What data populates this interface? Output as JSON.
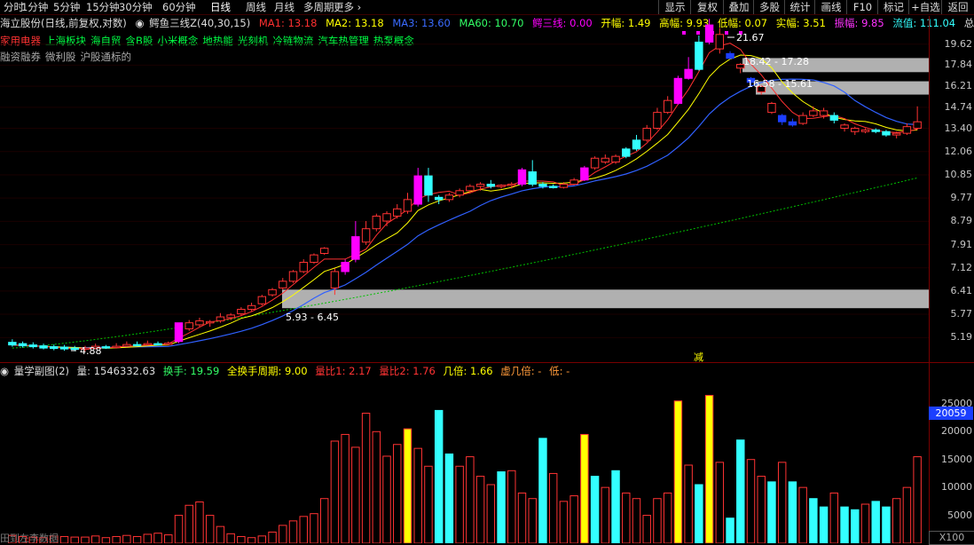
{
  "toolbar": {
    "periods": [
      "分时",
      "1分钟",
      "5分钟",
      "15分钟",
      "30分钟",
      "60分钟",
      "日线",
      "周线",
      "月线",
      "多周期",
      "更多 ›"
    ],
    "active_period": "日线",
    "right_buttons": [
      "显示",
      "复权",
      "叠加",
      "多股",
      "统计",
      "画线",
      "F10",
      "标记",
      "+自选",
      "返回"
    ]
  },
  "info": {
    "stock": "海立股份(日线,前复权,对数)",
    "indicator": "鳄鱼三线Z(40,30,15)",
    "ma1": "MA1: 13.18",
    "ma2": "MA2: 13.18",
    "ma3": "MA3: 13.60",
    "ma60": "MA60: 10.70",
    "e3": "鳄三线: 0.00",
    "open": "开幅: 1.49",
    "high": "高幅: 9.93",
    "low": "低幅: 0.07",
    "body": "实幅: 3.51",
    "amp": "振幅: 9.85",
    "float": "流值: 111.04",
    "total": "总值◇"
  },
  "concepts": [
    "家用电器",
    "上海板块",
    "海自贸",
    "含B股",
    "小米概念",
    "地热能",
    "光刻机",
    "冷链物流",
    "汽车热管理",
    "热泵概念"
  ],
  "tags": [
    "融资融券",
    "微利股",
    "沪股通标的"
  ],
  "volume_panel": {
    "title": "量学副图(2)",
    "vol": "量: 1546332.63",
    "turnover": "换手: 19.59",
    "full_turn": "全换手周期: 9.00",
    "ratio1": "量比1: 2.17",
    "ratio2": "量比2: 1.76",
    "times": "几倍: 1.66",
    "virtual": "虚几倍: -",
    "low": "低: -"
  },
  "price_axis": [
    "19.62",
    "17.84",
    "16.21",
    "14.74",
    "13.40",
    "12.06",
    "10.85",
    "9.77",
    "8.79",
    "7.91",
    "7.12",
    "6.41",
    "5.77",
    "5.19"
  ],
  "vol_axis": [
    "25000",
    "20000",
    "15000",
    "10000",
    "5000"
  ],
  "current_vol": "20059",
  "x_unit": "X100",
  "annotations": {
    "low_mark": "4.88",
    "high_mark": "21.67",
    "zone1": "18.42 - 17.28",
    "zone2": "16.58 - 15.61",
    "zone3": "5.93 - 6.45",
    "reduce": "减"
  },
  "bottom_text": "田到左李数据",
  "colors": {
    "up": "#ff3333",
    "down": "#33ffff",
    "magenta": "#ff00ff",
    "ma1": "#ff3030",
    "ma2": "#ffff00",
    "ma3": "#3060ff",
    "ma60": "#00c000",
    "zone": "#b0b0b0",
    "yellow_vol": "#ffff00"
  },
  "chart_data": {
    "type": "candlestick",
    "scale": "log",
    "ylim": [
      4.7,
      22.2
    ],
    "candles": [
      [
        5.08,
        5.02,
        5.15,
        4.98,
        "d"
      ],
      [
        5.05,
        5.0,
        5.1,
        4.96,
        "d"
      ],
      [
        5.02,
        4.98,
        5.08,
        4.94,
        "d"
      ],
      [
        5.0,
        4.95,
        5.05,
        4.92,
        "d"
      ],
      [
        4.98,
        4.94,
        5.03,
        4.9,
        "d"
      ],
      [
        4.97,
        4.93,
        5.02,
        4.89,
        "d"
      ],
      [
        4.95,
        4.92,
        5.0,
        4.88,
        "d"
      ],
      [
        4.93,
        4.95,
        5.0,
        4.88,
        "u"
      ],
      [
        4.95,
        4.99,
        5.05,
        4.92,
        "u"
      ],
      [
        4.98,
        4.96,
        5.02,
        4.93,
        "d"
      ],
      [
        4.96,
        4.99,
        5.06,
        4.94,
        "u"
      ],
      [
        4.99,
        5.03,
        5.1,
        4.97,
        "u"
      ],
      [
        5.03,
        5.02,
        5.1,
        4.99,
        "d"
      ],
      [
        5.02,
        5.05,
        5.12,
        5.0,
        "u"
      ],
      [
        5.05,
        5.04,
        5.1,
        5.01,
        "d"
      ],
      [
        5.04,
        5.06,
        5.1,
        5.02,
        "u"
      ],
      [
        5.1,
        5.55,
        5.55,
        5.06,
        "m"
      ],
      [
        5.4,
        5.55,
        5.62,
        5.35,
        "u"
      ],
      [
        5.5,
        5.6,
        5.68,
        5.45,
        "u"
      ],
      [
        5.55,
        5.58,
        5.62,
        5.45,
        "u"
      ],
      [
        5.6,
        5.7,
        5.8,
        5.55,
        "u"
      ],
      [
        5.68,
        5.75,
        5.8,
        5.62,
        "u"
      ],
      [
        5.78,
        5.9,
        5.96,
        5.74,
        "u"
      ],
      [
        5.9,
        6.0,
        6.08,
        5.85,
        "u"
      ],
      [
        6.05,
        6.25,
        6.3,
        6.0,
        "u"
      ],
      [
        6.3,
        6.45,
        6.5,
        6.25,
        "u"
      ],
      [
        6.5,
        6.7,
        6.8,
        6.45,
        "u"
      ],
      [
        6.7,
        7.0,
        7.05,
        6.65,
        "u"
      ],
      [
        7.0,
        7.3,
        7.4,
        6.95,
        "u"
      ],
      [
        7.3,
        7.55,
        7.6,
        7.25,
        "u"
      ],
      [
        7.6,
        7.78,
        7.82,
        7.55,
        "u"
      ],
      [
        6.5,
        7.0,
        7.1,
        6.3,
        "u"
      ],
      [
        7.0,
        7.3,
        7.4,
        6.9,
        "m"
      ],
      [
        7.4,
        8.2,
        8.8,
        7.3,
        "m"
      ],
      [
        8.0,
        8.5,
        8.8,
        7.9,
        "u"
      ],
      [
        8.5,
        9.0,
        9.1,
        8.4,
        "u"
      ],
      [
        8.8,
        9.1,
        9.2,
        8.6,
        "u"
      ],
      [
        9.0,
        9.3,
        9.5,
        8.9,
        "u"
      ],
      [
        9.2,
        9.7,
        10.0,
        9.1,
        "u"
      ],
      [
        9.5,
        10.8,
        11.2,
        9.4,
        "m"
      ],
      [
        10.8,
        9.9,
        11.2,
        9.6,
        "c"
      ],
      [
        9.8,
        9.7,
        9.9,
        9.5,
        "c"
      ],
      [
        9.7,
        9.9,
        10.0,
        9.6,
        "u"
      ],
      [
        9.9,
        10.1,
        10.2,
        9.8,
        "u"
      ],
      [
        10.1,
        10.3,
        10.4,
        10.0,
        "u"
      ],
      [
        10.3,
        10.4,
        10.5,
        10.1,
        "u"
      ],
      [
        10.4,
        10.3,
        10.6,
        10.2,
        "c"
      ],
      [
        10.3,
        10.35,
        10.4,
        10.2,
        "u"
      ],
      [
        10.35,
        10.4,
        10.5,
        10.2,
        "u"
      ],
      [
        10.4,
        11.1,
        11.2,
        10.3,
        "m"
      ],
      [
        11.0,
        10.4,
        11.6,
        10.3,
        "c"
      ],
      [
        10.4,
        10.3,
        10.5,
        10.2,
        "c"
      ],
      [
        10.3,
        10.25,
        10.4,
        10.2,
        "c"
      ],
      [
        10.25,
        10.4,
        10.5,
        10.2,
        "u"
      ],
      [
        10.4,
        10.6,
        10.7,
        10.35,
        "u"
      ],
      [
        10.6,
        11.2,
        11.3,
        10.55,
        "m"
      ],
      [
        11.2,
        11.7,
        11.8,
        11.1,
        "u"
      ],
      [
        11.7,
        11.5,
        11.9,
        11.4,
        "u"
      ],
      [
        11.5,
        11.8,
        11.9,
        11.4,
        "u"
      ],
      [
        11.8,
        12.2,
        12.3,
        11.7,
        "c"
      ],
      [
        12.2,
        12.7,
        13.0,
        12.1,
        "c"
      ],
      [
        12.7,
        13.4,
        13.6,
        12.6,
        "u"
      ],
      [
        13.4,
        14.4,
        14.7,
        13.3,
        "u"
      ],
      [
        14.4,
        15.2,
        15.5,
        14.3,
        "u"
      ],
      [
        15.0,
        16.8,
        17.0,
        14.9,
        "m"
      ],
      [
        16.8,
        17.5,
        18.5,
        16.7,
        "m"
      ],
      [
        17.5,
        19.8,
        20.4,
        17.4,
        "c"
      ],
      [
        19.8,
        21.4,
        22.0,
        19.6,
        "m"
      ],
      [
        20.5,
        19.2,
        21.1,
        18.8,
        "u"
      ],
      [
        18.8,
        18.4,
        19.0,
        18.3,
        "b"
      ],
      [
        17.9,
        17.6,
        18.0,
        17.2,
        "u"
      ],
      [
        16.8,
        16.5,
        16.9,
        16.2,
        "b"
      ],
      [
        16.2,
        15.8,
        16.3,
        15.6,
        "u"
      ],
      [
        15.0,
        14.4,
        15.1,
        14.3,
        "u"
      ],
      [
        14.2,
        13.8,
        14.3,
        13.6,
        "b"
      ],
      [
        13.8,
        13.6,
        14.0,
        13.5,
        "b"
      ],
      [
        13.7,
        14.2,
        14.4,
        13.6,
        "u"
      ],
      [
        14.2,
        14.5,
        14.8,
        14.1,
        "u"
      ],
      [
        14.5,
        14.2,
        14.7,
        14.0,
        "u"
      ],
      [
        14.2,
        13.9,
        14.4,
        13.7,
        "c"
      ],
      [
        13.6,
        13.4,
        13.7,
        13.2,
        "u"
      ],
      [
        13.4,
        13.2,
        13.5,
        13.0,
        "u"
      ],
      [
        13.2,
        13.3,
        13.4,
        13.1,
        "u"
      ],
      [
        13.3,
        13.2,
        13.4,
        13.1,
        "c"
      ],
      [
        13.2,
        13.0,
        13.3,
        12.9,
        "c"
      ],
      [
        13.0,
        13.1,
        13.2,
        12.8,
        "u"
      ],
      [
        13.1,
        13.5,
        13.7,
        13.0,
        "u"
      ],
      [
        13.4,
        13.8,
        14.8,
        13.3,
        "u"
      ]
    ],
    "volume": [
      [
        1400,
        "u"
      ],
      [
        1200,
        "u"
      ],
      [
        1100,
        "u"
      ],
      [
        1000,
        "u"
      ],
      [
        1300,
        "u"
      ],
      [
        1200,
        "u"
      ],
      [
        1100,
        "u"
      ],
      [
        1100,
        "u"
      ],
      [
        1300,
        "u"
      ],
      [
        1000,
        "u"
      ],
      [
        1200,
        "u"
      ],
      [
        1400,
        "u"
      ],
      [
        1200,
        "u"
      ],
      [
        1600,
        "u"
      ],
      [
        1800,
        "u"
      ],
      [
        1500,
        "u"
      ],
      [
        5000,
        "u"
      ],
      [
        6800,
        "u"
      ],
      [
        7400,
        "u"
      ],
      [
        5000,
        "u"
      ],
      [
        3000,
        "u"
      ],
      [
        1700,
        "u"
      ],
      [
        1200,
        "u"
      ],
      [
        1000,
        "u"
      ],
      [
        1300,
        "u"
      ],
      [
        2000,
        "u"
      ],
      [
        3200,
        "u"
      ],
      [
        4000,
        "u"
      ],
      [
        4800,
        "u"
      ],
      [
        5300,
        "u"
      ],
      [
        8000,
        "u"
      ],
      [
        18300,
        "u"
      ],
      [
        19500,
        "u"
      ],
      [
        17200,
        "u"
      ],
      [
        23300,
        "u"
      ],
      [
        20000,
        "u"
      ],
      [
        15600,
        "u"
      ],
      [
        17700,
        "u"
      ],
      [
        20500,
        "y"
      ],
      [
        17000,
        "u"
      ],
      [
        13800,
        "u"
      ],
      [
        23800,
        "c"
      ],
      [
        16000,
        "c"
      ],
      [
        13800,
        "u"
      ],
      [
        15500,
        "u"
      ],
      [
        12000,
        "u"
      ],
      [
        10500,
        "u"
      ],
      [
        12800,
        "c"
      ],
      [
        13000,
        "u"
      ],
      [
        9000,
        "u"
      ],
      [
        8000,
        "u"
      ],
      [
        18800,
        "c"
      ],
      [
        12500,
        "u"
      ],
      [
        7500,
        "u"
      ],
      [
        8500,
        "u"
      ],
      [
        19500,
        "y"
      ],
      [
        12000,
        "c"
      ],
      [
        10000,
        "u"
      ],
      [
        13000,
        "c"
      ],
      [
        9000,
        "u"
      ],
      [
        8000,
        "u"
      ],
      [
        5000,
        "u"
      ],
      [
        8000,
        "u"
      ],
      [
        9000,
        "u"
      ],
      [
        25500,
        "y"
      ],
      [
        14000,
        "u"
      ],
      [
        10500,
        "c"
      ],
      [
        26500,
        "y"
      ],
      [
        14500,
        "u"
      ],
      [
        4500,
        "c"
      ],
      [
        18500,
        "c"
      ],
      [
        15000,
        "u"
      ],
      [
        12000,
        "u"
      ],
      [
        11000,
        "c"
      ],
      [
        14500,
        "u"
      ],
      [
        11000,
        "c"
      ],
      [
        10000,
        "u"
      ],
      [
        8000,
        "c"
      ],
      [
        6500,
        "c"
      ],
      [
        9000,
        "u"
      ],
      [
        6500,
        "c"
      ],
      [
        6000,
        "c"
      ],
      [
        7000,
        "u"
      ],
      [
        7500,
        "c"
      ],
      [
        6500,
        "c"
      ],
      [
        8000,
        "u"
      ],
      [
        10000,
        "u"
      ],
      [
        15500,
        "u"
      ]
    ],
    "zones": [
      [
        18.42,
        17.28
      ],
      [
        16.58,
        15.61
      ],
      [
        5.93,
        6.45
      ]
    ],
    "vol_ylim": [
      0,
      28000
    ]
  }
}
